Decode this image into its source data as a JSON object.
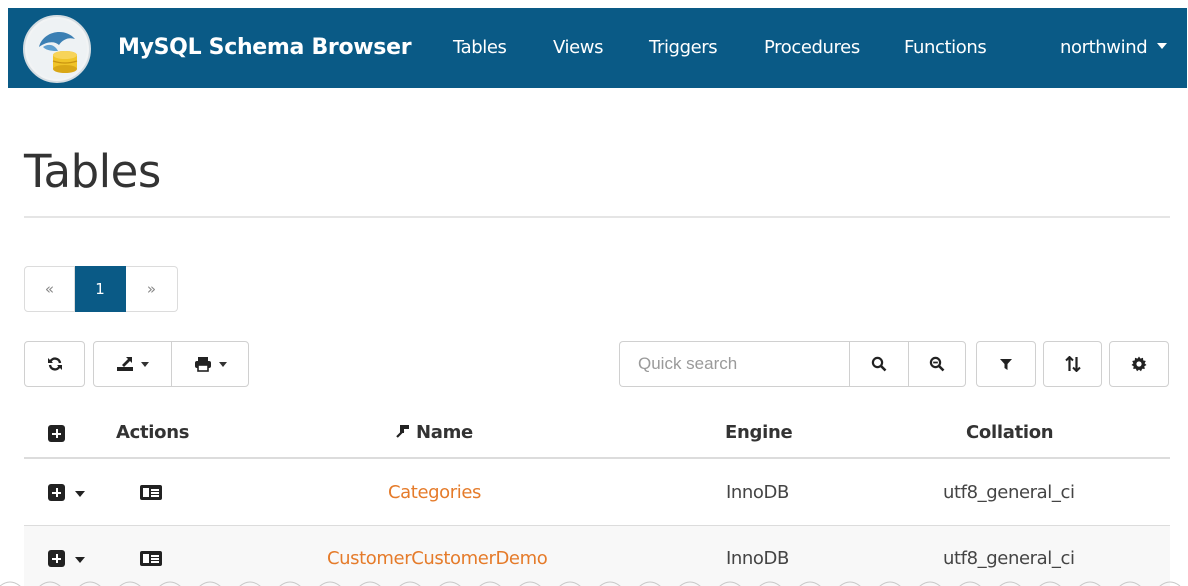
{
  "navbar": {
    "brand": "MySQL Schema Browser",
    "logo_icon": "mysql-dolphin-database-logo",
    "items": [
      {
        "label": "Tables"
      },
      {
        "label": "Views"
      },
      {
        "label": "Triggers"
      },
      {
        "label": "Procedures"
      },
      {
        "label": "Functions"
      }
    ],
    "database_menu": {
      "label": "northwind",
      "icon": "caret-down-icon"
    },
    "colors": {
      "background": "#0a5a86",
      "text": "#ffffff"
    }
  },
  "page": {
    "title": "Tables"
  },
  "pagination": {
    "prev": "«",
    "current": "1",
    "next": "»"
  },
  "toolbar": {
    "refresh_icon": "refresh-icon",
    "export_icon": "export-icon",
    "print_icon": "print-icon",
    "search": {
      "placeholder": "Quick search",
      "value": ""
    },
    "search_icon": "search-icon",
    "advanced_search_icon": "zoom-out-icon",
    "filter_icon": "filter-icon",
    "sort_icon": "sort-icon",
    "settings_icon": "gear-icon"
  },
  "table": {
    "columns": {
      "expand_all_icon": "plus-square-icon",
      "actions": "Actions",
      "name": "Name",
      "name_icon": "key-icon",
      "engine": "Engine",
      "collation": "Collation"
    },
    "rows": [
      {
        "name": "Categories",
        "engine": "InnoDB",
        "collation": "utf8_general_ci"
      },
      {
        "name": "CustomerCustomerDemo",
        "engine": "InnoDB",
        "collation": "utf8_general_ci"
      }
    ],
    "colors": {
      "link": "#e57b2a"
    }
  }
}
